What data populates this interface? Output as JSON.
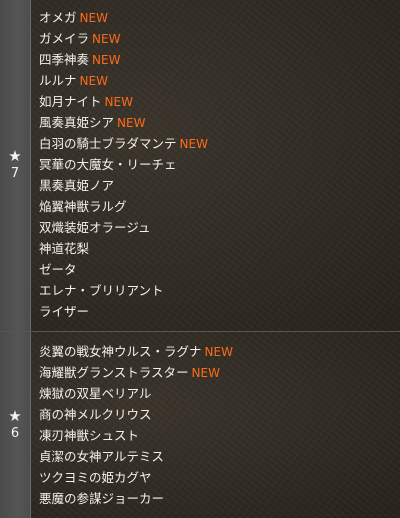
{
  "groups": [
    {
      "rank": "7",
      "star_icon": "★",
      "items": [
        {
          "name": "オメガ",
          "new": "NEW"
        },
        {
          "name": "ガメイラ",
          "new": "NEW"
        },
        {
          "name": "四季神奏",
          "new": "NEW"
        },
        {
          "name": "ルルナ",
          "new": "NEW"
        },
        {
          "name": "如月ナイト",
          "new": "NEW"
        },
        {
          "name": "風奏真姫シア",
          "new": "NEW"
        },
        {
          "name": "白羽の騎士ブラダマンテ",
          "new": "NEW"
        },
        {
          "name": "冥華の大魔女・リーチェ",
          "new": ""
        },
        {
          "name": "黒奏真姫ノア",
          "new": ""
        },
        {
          "name": "焔翼神獣ラルグ",
          "new": ""
        },
        {
          "name": "双熾装姫オラージュ",
          "new": ""
        },
        {
          "name": "神道花梨",
          "new": ""
        },
        {
          "name": "ゼータ",
          "new": ""
        },
        {
          "name": "エレナ・ブリリアント",
          "new": ""
        },
        {
          "name": "ライザー",
          "new": ""
        }
      ]
    },
    {
      "rank": "6",
      "star_icon": "★",
      "items": [
        {
          "name": "炎翼の戦女神ウルス・ラグナ",
          "new": "NEW"
        },
        {
          "name": "海耀獣グランストラスター",
          "new": "NEW"
        },
        {
          "name": "煉獄の双星ベリアル",
          "new": ""
        },
        {
          "name": "商の神メルクリウス",
          "new": ""
        },
        {
          "name": "凍刃神獣シュスト",
          "new": ""
        },
        {
          "name": "貞潔の女神アルテミス",
          "new": ""
        },
        {
          "name": "ツクヨミの姫カグヤ",
          "new": ""
        },
        {
          "name": "悪魔の参謀ジョーカー",
          "new": ""
        }
      ]
    }
  ]
}
